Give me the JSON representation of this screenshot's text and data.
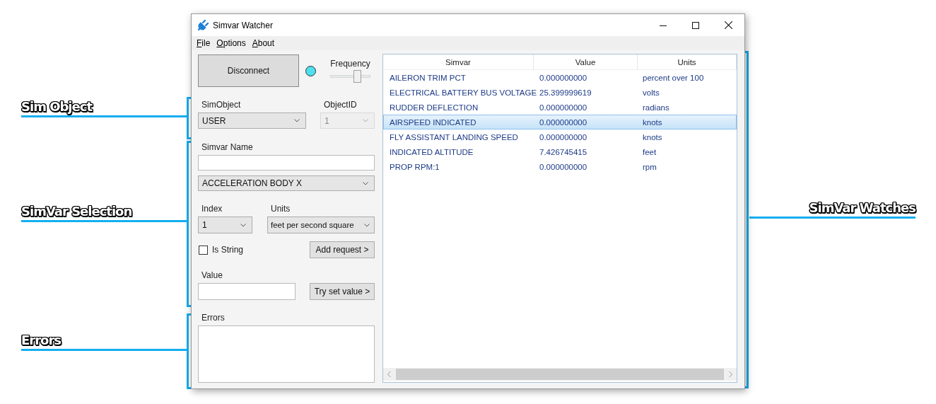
{
  "window": {
    "title": "Simvar Watcher"
  },
  "menu": [
    {
      "access_key": "F",
      "label_rest": "ile"
    },
    {
      "access_key": "O",
      "label_rest": "ptions"
    },
    {
      "access_key": "A",
      "label_rest": "bout"
    }
  ],
  "connection": {
    "button": "Disconnect",
    "connected": true
  },
  "frequency": {
    "label": "Frequency",
    "level": 0.68
  },
  "sim_object": {
    "label": "SimObject",
    "value": "USER"
  },
  "object_id": {
    "label": "ObjectID",
    "value": "1",
    "disabled": true
  },
  "simvar_name": {
    "label": "Simvar Name",
    "selected": "ACCELERATION BODY X"
  },
  "index": {
    "label": "Index",
    "value": "1"
  },
  "units": {
    "label": "Units",
    "value": "feet per second square"
  },
  "is_string": {
    "label": "Is String",
    "checked": false
  },
  "add_button": "Add request >",
  "value": {
    "label": "Value"
  },
  "set_button": "Try set value >",
  "errors": {
    "label": "Errors"
  },
  "watches": {
    "columns": [
      "Simvar",
      "Value",
      "Units"
    ],
    "rows": [
      {
        "simvar": "AILERON TRIM PCT",
        "value": "0.000000000",
        "units": "percent over 100",
        "selected": false
      },
      {
        "simvar": "ELECTRICAL BATTERY BUS VOLTAGE",
        "value": "25.399999619",
        "units": "volts",
        "selected": false
      },
      {
        "simvar": "RUDDER DEFLECTION",
        "value": "0.000000000",
        "units": "radians",
        "selected": false
      },
      {
        "simvar": "AIRSPEED INDICATED",
        "value": "0.000000000",
        "units": "knots",
        "selected": true
      },
      {
        "simvar": "FLY ASSISTANT LANDING SPEED",
        "value": "0.000000000",
        "units": "knots",
        "selected": false
      },
      {
        "simvar": "INDICATED ALTITUDE",
        "value": "7.426745415",
        "units": "feet",
        "selected": false
      },
      {
        "simvar": "PROP RPM:1",
        "value": "0.000000000",
        "units": "rpm",
        "selected": false
      }
    ]
  },
  "annotations": [
    {
      "label": "Sim Object"
    },
    {
      "label": "SimVar Selection"
    },
    {
      "label": "Errors"
    },
    {
      "label": "SimVar Watches"
    }
  ]
}
